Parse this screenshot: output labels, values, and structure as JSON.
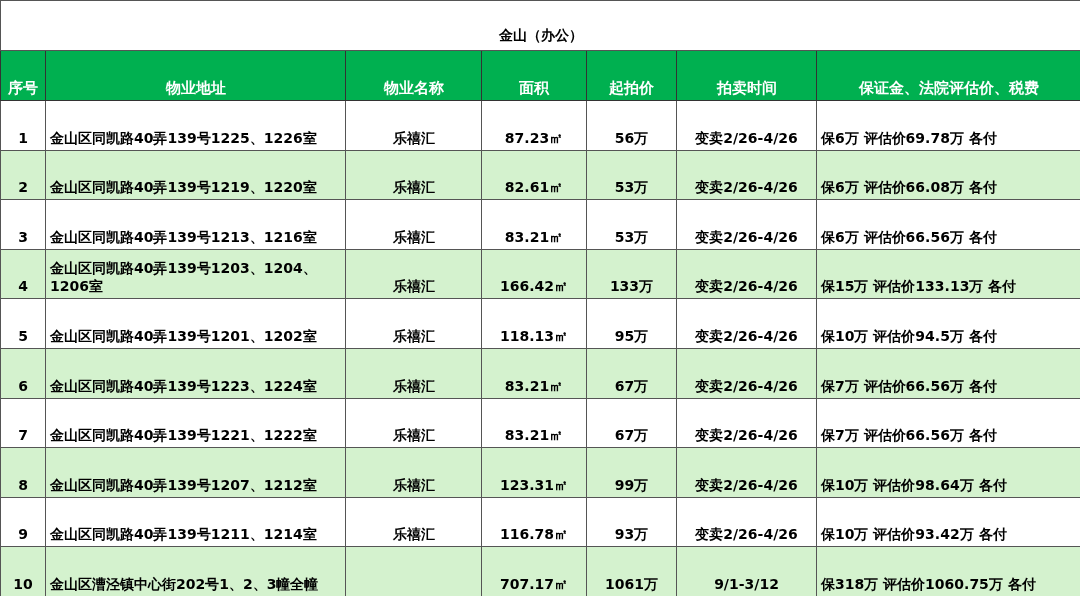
{
  "title": "金山（办公）",
  "columns": [
    "序号",
    "物业地址",
    "物业名称",
    "面积",
    "起拍价",
    "拍卖时间",
    "保证金、法院评估价、税费"
  ],
  "rows": [
    {
      "cells": [
        "1",
        "金山区同凯路40弄139号1225、1226室",
        "乐禧汇",
        "87.23㎡",
        "56万",
        "变卖2/26-4/26",
        "保6万 评估价69.78万 各付"
      ]
    },
    {
      "cells": [
        "2",
        "金山区同凯路40弄139号1219、1220室",
        "乐禧汇",
        "82.61㎡",
        "53万",
        "变卖2/26-4/26",
        "保6万 评估价66.08万 各付"
      ]
    },
    {
      "cells": [
        "3",
        "金山区同凯路40弄139号1213、1216室",
        "乐禧汇",
        "83.21㎡",
        "53万",
        "变卖2/26-4/26",
        "保6万 评估价66.56万 各付"
      ]
    },
    {
      "cells": [
        "4",
        "金山区同凯路40弄139号1203、1204、1206室",
        "乐禧汇",
        "166.42㎡",
        "133万",
        "变卖2/26-4/26",
        "保15万 评估价133.13万 各付"
      ]
    },
    {
      "cells": [
        "5",
        "金山区同凯路40弄139号1201、1202室",
        "乐禧汇",
        "118.13㎡",
        "95万",
        "变卖2/26-4/26",
        "保10万 评估价94.5万 各付"
      ]
    },
    {
      "cells": [
        "6",
        "金山区同凯路40弄139号1223、1224室",
        "乐禧汇",
        "83.21㎡",
        "67万",
        "变卖2/26-4/26",
        "保7万 评估价66.56万 各付"
      ]
    },
    {
      "cells": [
        "7",
        "金山区同凯路40弄139号1221、1222室",
        "乐禧汇",
        "83.21㎡",
        "67万",
        "变卖2/26-4/26",
        "保7万 评估价66.56万 各付"
      ]
    },
    {
      "cells": [
        "8",
        "金山区同凯路40弄139号1207、1212室",
        "乐禧汇",
        "123.31㎡",
        "99万",
        "变卖2/26-4/26",
        "保10万 评估价98.64万 各付"
      ]
    },
    {
      "cells": [
        "9",
        "金山区同凯路40弄139号1211、1214室",
        "乐禧汇",
        "116.78㎡",
        "93万",
        "变卖2/26-4/26",
        "保10万 评估价93.42万 各付"
      ]
    },
    {
      "cells": [
        "10",
        "金山区漕泾镇中心街202号1、2、3幢全幢",
        "",
        "707.17㎡",
        "1061万",
        "9/1-3/12",
        "保318万 评估价1060.75万 各付"
      ]
    }
  ]
}
